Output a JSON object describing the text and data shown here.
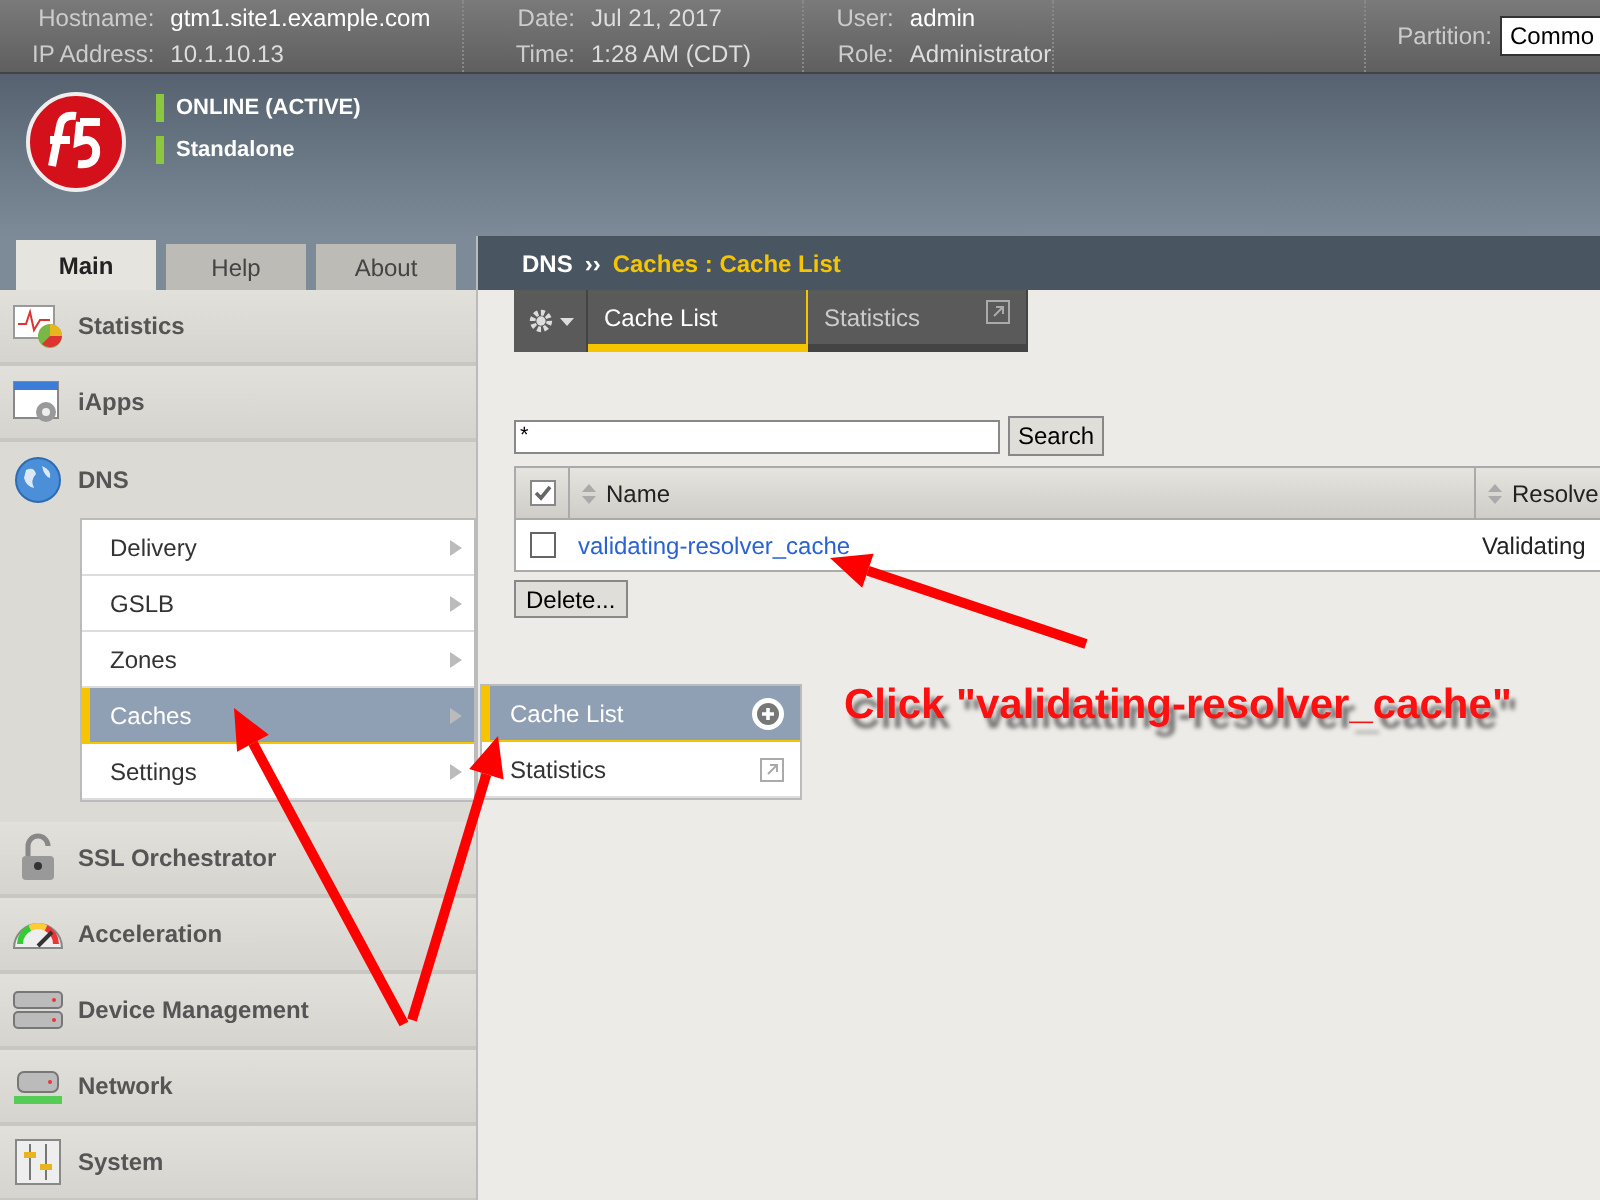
{
  "header": {
    "hostname_label": "Hostname:",
    "hostname": "gtm1.site1.example.com",
    "ip_label": "IP Address:",
    "ip": "10.1.10.13",
    "date_label": "Date:",
    "date": "Jul 21, 2017",
    "time_label": "Time:",
    "time": "1:28 AM (CDT)",
    "user_label": "User:",
    "user": "admin",
    "role_label": "Role:",
    "role": "Administrator",
    "partition_label": "Partition:",
    "partition": "Commo"
  },
  "status": [
    "ONLINE (ACTIVE)",
    "Standalone"
  ],
  "nav_tabs": [
    {
      "label": "Main",
      "selected": true
    },
    {
      "label": "Help",
      "selected": false
    },
    {
      "label": "About",
      "selected": false
    }
  ],
  "sidebar": [
    {
      "label": "Statistics",
      "expanded": false
    },
    {
      "label": "iApps",
      "expanded": false
    },
    {
      "label": "DNS",
      "expanded": true,
      "children": [
        {
          "label": "Delivery",
          "selected": false
        },
        {
          "label": "GSLB",
          "selected": false
        },
        {
          "label": "Zones",
          "selected": false
        },
        {
          "label": "Caches",
          "selected": true
        },
        {
          "label": "Settings",
          "selected": false
        }
      ]
    },
    {
      "label": "SSL Orchestrator",
      "expanded": false
    },
    {
      "label": "Acceleration",
      "expanded": false
    },
    {
      "label": "Device Management",
      "expanded": false
    },
    {
      "label": "Network",
      "expanded": false
    },
    {
      "label": "System",
      "expanded": false
    }
  ],
  "flyout": [
    {
      "label": "Cache List",
      "selected": true,
      "kind": "add"
    },
    {
      "label": "Statistics",
      "selected": false,
      "kind": "external"
    }
  ],
  "breadcrumb": {
    "section": "DNS",
    "separator": "››",
    "path": "Caches : Cache List"
  },
  "page_tabs": [
    {
      "label": "Cache List",
      "selected": true,
      "kind": "plain"
    },
    {
      "label": "Statistics",
      "selected": false,
      "kind": "external"
    }
  ],
  "search": {
    "value": "*",
    "button": "Search"
  },
  "table": {
    "select_all_checked": true,
    "columns": [
      {
        "label": "Name"
      },
      {
        "label": "Resolve"
      }
    ],
    "rows": [
      {
        "checked": false,
        "name": "validating-resolver_cache",
        "type": "Validating"
      }
    ]
  },
  "delete_button": "Delete...",
  "annotation": {
    "text": "Click \"validating-resolver_cache\""
  }
}
